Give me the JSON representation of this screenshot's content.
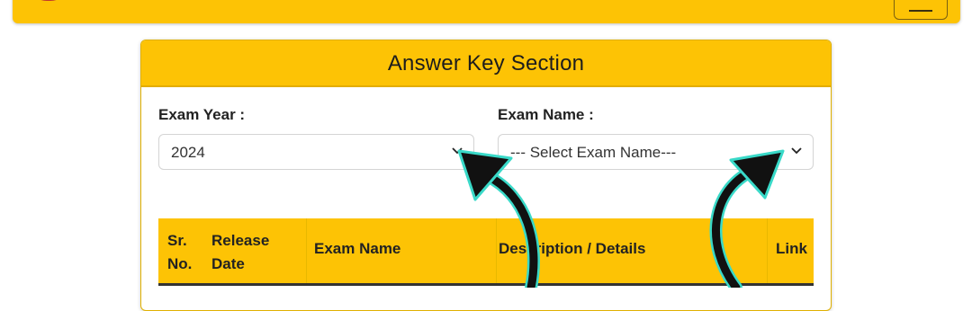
{
  "section_title": "Answer Key Section",
  "filters": {
    "exam_year": {
      "label": "Exam Year :",
      "value": "2024"
    },
    "exam_name": {
      "label": "Exam Name :",
      "value": "--- Select Exam Name---"
    }
  },
  "table": {
    "headers": {
      "sr_line1": "Sr.",
      "sr_line2": "No.",
      "release_line1": "Release",
      "release_line2": "Date",
      "exam_name": "Exam Name",
      "description": "Description / Details",
      "link": "Link"
    }
  },
  "colors": {
    "brand_yellow": "#fdc305",
    "arrow_glow": "#39d9c8",
    "arrow_fill": "#111111"
  },
  "icons": [
    "logo-icon",
    "hamburger-menu-icon",
    "chevron-down-icon",
    "annotation-arrow"
  ]
}
